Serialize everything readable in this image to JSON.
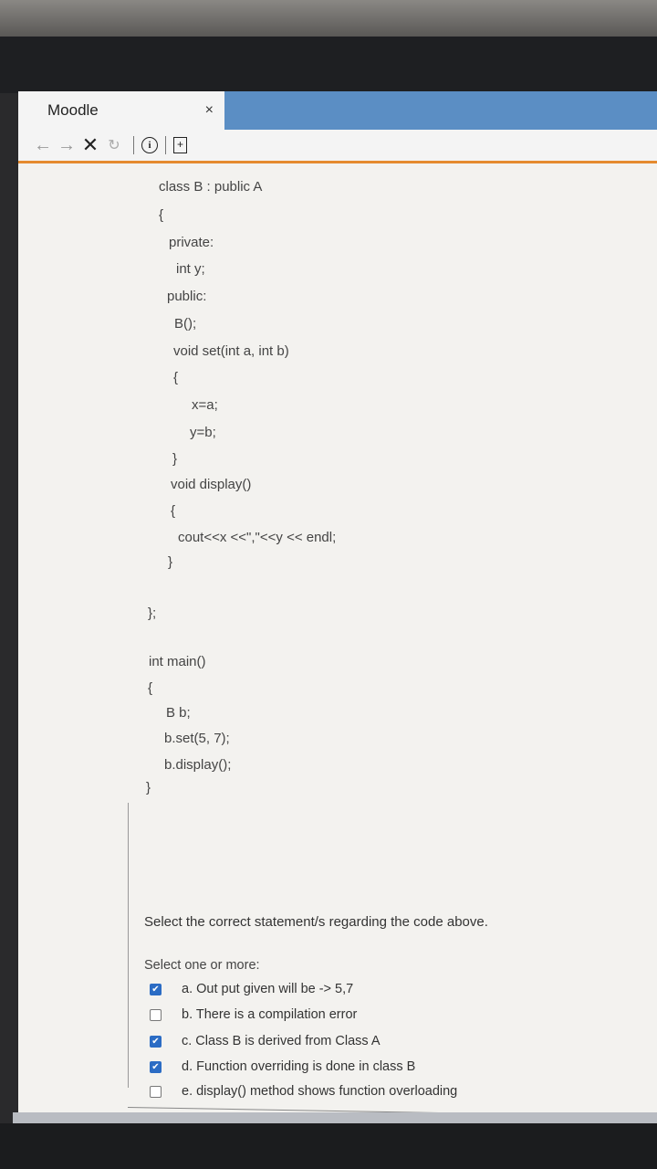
{
  "browser": {
    "tab_title": "Moodle",
    "tab_close": "×",
    "nav": {
      "back": "←",
      "forward": "→",
      "stop": "✕",
      "reload": "↻",
      "info": "i",
      "page": "+"
    }
  },
  "code": {
    "class_decl": "class B : public A",
    "open1": "{",
    "private": "private:",
    "int_y": "int y;",
    "public": "public:",
    "ctor": "B();",
    "set_sig": "void set(int a, int b)",
    "open2": "{",
    "xa": "x=a;",
    "yb": "y=b;",
    "close2": "}",
    "display_sig": "void display()",
    "open3": "{",
    "cout": "cout<<x <<\",\"<<y << endl;",
    "close3": "}",
    "class_end": "};",
    "main_sig": "int main()",
    "open4": "{",
    "bb": "B b;",
    "bset": "b.set(5, 7);",
    "bdisplay": "b.display();",
    "close4": "}"
  },
  "question": {
    "text": "Select the correct statement/s regarding the code above.",
    "select_label": "Select one or more:",
    "options": [
      {
        "label": "a. Out put given will be -> 5,7",
        "checked": true
      },
      {
        "label": "b. There is a compilation error",
        "checked": false
      },
      {
        "label": "c. Class B is derived from Class A",
        "checked": true
      },
      {
        "label": "d. Function overriding is done in class B",
        "checked": true
      },
      {
        "label": "e. display() method shows function overloading",
        "checked": false
      }
    ]
  }
}
